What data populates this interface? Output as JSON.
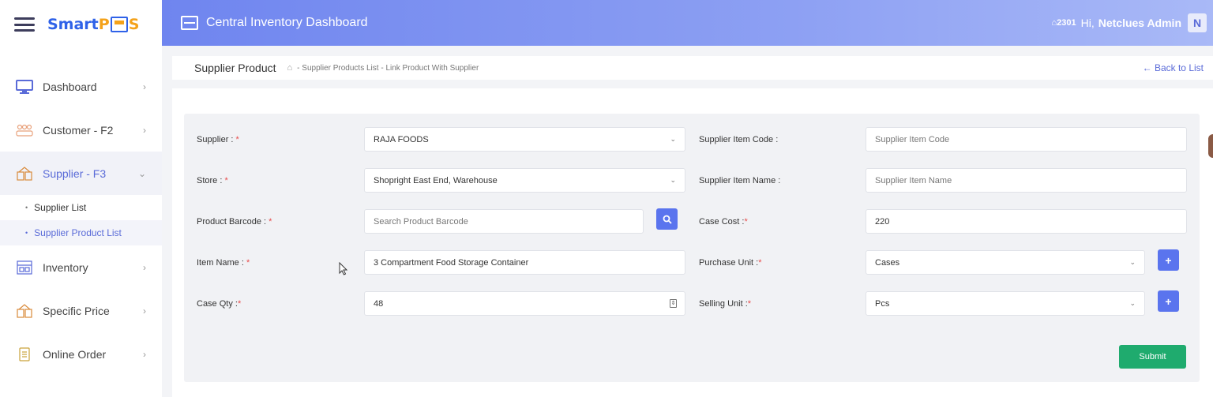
{
  "brand": {
    "name_a": "Smart ",
    "name_p": "P",
    "name_s": "S"
  },
  "sidebar": {
    "items": [
      {
        "label": "Dashboard",
        "chev": "›"
      },
      {
        "label": "Customer - F2",
        "chev": "›"
      },
      {
        "label": "Supplier - F3",
        "chev": "⌄"
      },
      {
        "label": "Inventory",
        "chev": "›"
      },
      {
        "label": "Specific Price",
        "chev": "›"
      },
      {
        "label": "Online Order",
        "chev": "›"
      }
    ],
    "subitems": [
      {
        "label": "Supplier List"
      },
      {
        "label": "Supplier Product List"
      }
    ]
  },
  "header": {
    "title": "Central Inventory Dashboard",
    "notif": "2301",
    "hi": "Hi,",
    "admin": "Netclues Admin",
    "avatar": "N"
  },
  "breadcrumb": {
    "page_title": "Supplier Product",
    "crumbs": "- Supplier Products List - Link Product With Supplier",
    "back": "← Back to List"
  },
  "form": {
    "supplier_label": "Supplier : ",
    "supplier_value": "RAJA FOODS",
    "store_label": "Store : ",
    "store_value": "Shopright East End, Warehouse",
    "barcode_label": "Product Barcode : ",
    "barcode_placeholder": "Search Product Barcode",
    "item_name_label": "Item Name : ",
    "item_name_value": "3 Compartment Food Storage Container",
    "case_qty_label": "Case Qty :",
    "case_qty_value": "48",
    "supplier_item_code_label": "Supplier Item Code :",
    "supplier_item_code_placeholder": "Supplier Item Code",
    "supplier_item_name_label": "Supplier Item Name :",
    "supplier_item_name_placeholder": "Supplier Item Name",
    "case_cost_label": "Case Cost :",
    "case_cost_value": "220",
    "purchase_unit_label": "Purchase Unit :",
    "purchase_unit_value": "Cases",
    "selling_unit_label": "Selling Unit :",
    "selling_unit_value": "Pcs",
    "required_mark": "*",
    "submit_label": "Submit"
  }
}
